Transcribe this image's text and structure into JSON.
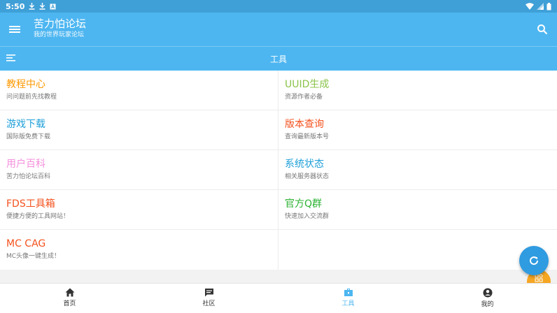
{
  "status_bar": {
    "time": "5:50"
  },
  "app_bar": {
    "title": "苦力怕论坛",
    "subtitle": "我的世界玩家论坛"
  },
  "tool_bar": {
    "title": "工具"
  },
  "tools": [
    {
      "name": "教程中心",
      "desc": "问问题前先找教程",
      "color": "#ff9800"
    },
    {
      "name": "UUID生成",
      "desc": "资源作者必备",
      "color": "#8bc34a"
    },
    {
      "name": "游戏下载",
      "desc": "国际版免费下载",
      "color": "#1e9fd8"
    },
    {
      "name": "版本查询",
      "desc": "查询最新版本号",
      "color": "#f4511e"
    },
    {
      "name": "用户百科",
      "desc": "苦力怕论坛百科",
      "color": "#f48fdc"
    },
    {
      "name": "系统状态",
      "desc": "相关服务器状态",
      "color": "#1e9fd8"
    },
    {
      "name": "FDS工具箱",
      "desc": "便捷方便的工具网站！",
      "color": "#f4511e"
    },
    {
      "name": "官方Q群",
      "desc": "快速加入交流群",
      "color": "#2bb232"
    },
    {
      "name": "MC CAG",
      "desc": "MC头像一键生成！",
      "color": "#f4511e"
    }
  ],
  "bottom_nav": [
    {
      "label": "首页",
      "icon": "home-icon"
    },
    {
      "label": "社区",
      "icon": "chat-icon"
    },
    {
      "label": "工具",
      "icon": "toolbox-icon",
      "active": true
    },
    {
      "label": "我的",
      "icon": "account-icon"
    }
  ],
  "colors": {
    "accent": "#4db6f1",
    "status_bar": "#3f9fd7",
    "fab": "#2f9be0",
    "fab_secondary": "#f5a623"
  }
}
